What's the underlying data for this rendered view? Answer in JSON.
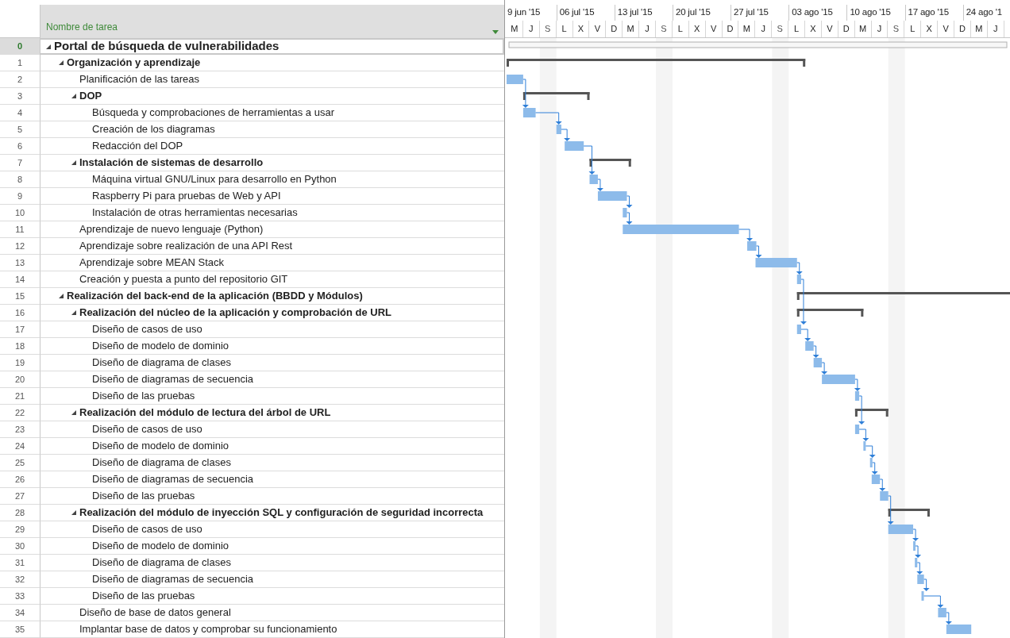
{
  "table": {
    "column_header": "Nombre de tarea"
  },
  "timescale": {
    "days": [
      {
        "label": "M",
        "nonworking": false
      },
      {
        "label": "J",
        "nonworking": false
      },
      {
        "label": "S",
        "nonworking": true
      },
      {
        "label": "L",
        "nonworking": false
      },
      {
        "label": "X",
        "nonworking": false
      },
      {
        "label": "V",
        "nonworking": false
      },
      {
        "label": "D",
        "nonworking": false
      },
      {
        "label": "M",
        "nonworking": false
      },
      {
        "label": "J",
        "nonworking": false
      },
      {
        "label": "S",
        "nonworking": true
      },
      {
        "label": "L",
        "nonworking": false
      },
      {
        "label": "X",
        "nonworking": false
      },
      {
        "label": "V",
        "nonworking": false
      },
      {
        "label": "D",
        "nonworking": false
      },
      {
        "label": "M",
        "nonworking": false
      },
      {
        "label": "J",
        "nonworking": false
      },
      {
        "label": "S",
        "nonworking": true
      },
      {
        "label": "L",
        "nonworking": false
      },
      {
        "label": "X",
        "nonworking": false
      },
      {
        "label": "V",
        "nonworking": false
      },
      {
        "label": "D",
        "nonworking": false
      },
      {
        "label": "M",
        "nonworking": false
      },
      {
        "label": "J",
        "nonworking": false
      },
      {
        "label": "S",
        "nonworking": true
      },
      {
        "label": "L",
        "nonworking": false
      },
      {
        "label": "X",
        "nonworking": false
      },
      {
        "label": "V",
        "nonworking": false
      },
      {
        "label": "D",
        "nonworking": false
      },
      {
        "label": "M",
        "nonworking": false
      },
      {
        "label": "J",
        "nonworking": false
      }
    ]
  },
  "weeks": [
    {
      "label": "9 jun '15"
    },
    {
      "label": "06 jul '15"
    },
    {
      "label": "13 jul '15"
    },
    {
      "label": "20 jul '15"
    },
    {
      "label": "27 jul '15"
    },
    {
      "label": "03 ago '15"
    },
    {
      "label": "10 ago '15"
    },
    {
      "label": "17 ago '15"
    },
    {
      "label": "24 ago '1"
    }
  ],
  "tasks": [
    {
      "id": "0",
      "name": "Portal de búsqueda de vulnerabilidades",
      "selected": true,
      "expanded": true,
      "children": [
        {
          "id": "1",
          "name": "Organización y aprendizaje",
          "selected": false,
          "expanded": true,
          "children": [
            {
              "id": "2",
              "name": "Planificación de las tareas",
              "selected": false
            },
            {
              "id": "3",
              "name": "DOP",
              "selected": false,
              "expanded": true,
              "children": [
                {
                  "id": "4",
                  "name": "Búsqueda y comprobaciones de herramientas a usar",
                  "selected": false
                },
                {
                  "id": "5",
                  "name": "Creación de los diagramas",
                  "selected": false
                },
                {
                  "id": "6",
                  "name": "Redacción del DOP",
                  "selected": false
                }
              ]
            },
            {
              "id": "7",
              "name": "Instalación de sistemas de desarrollo",
              "selected": false,
              "expanded": true,
              "children": [
                {
                  "id": "8",
                  "name": "Máquina virtual GNU/Linux para desarrollo en Python",
                  "selected": false
                },
                {
                  "id": "9",
                  "name": "Raspberry Pi para pruebas de Web y API",
                  "selected": false
                },
                {
                  "id": "10",
                  "name": "Instalación de otras herramientas necesarias",
                  "selected": false
                }
              ]
            },
            {
              "id": "11",
              "name": "Aprendizaje de nuevo lenguaje (Python)",
              "selected": false
            },
            {
              "id": "12",
              "name": "Aprendizaje sobre realización de una API Rest",
              "selected": false
            },
            {
              "id": "13",
              "name": "Aprendizaje sobre MEAN Stack",
              "selected": false
            },
            {
              "id": "14",
              "name": "Creación y puesta a punto del repositorio GIT",
              "selected": false
            }
          ]
        },
        {
          "id": "15",
          "name": "Realización del back-end de la aplicación (BBDD y Módulos)",
          "selected": false,
          "expanded": true,
          "children": [
            {
              "id": "16",
              "name": "Realización del núcleo de la aplicación y comprobación de URL",
              "selected": false,
              "expanded": true,
              "children": [
                {
                  "id": "17",
                  "name": "Diseño de casos de uso",
                  "selected": false
                },
                {
                  "id": "18",
                  "name": "Diseño de modelo de dominio",
                  "selected": false
                },
                {
                  "id": "19",
                  "name": "Diseño de diagrama de clases",
                  "selected": false
                },
                {
                  "id": "20",
                  "name": "Diseño de diagramas de secuencia",
                  "selected": false
                },
                {
                  "id": "21",
                  "name": "Diseño de las pruebas",
                  "selected": false
                }
              ]
            },
            {
              "id": "22",
              "name": "Realización del módulo de lectura del árbol de URL",
              "selected": false,
              "expanded": true,
              "children": [
                {
                  "id": "23",
                  "name": "Diseño de casos de uso",
                  "selected": false
                },
                {
                  "id": "24",
                  "name": "Diseño de modelo de dominio",
                  "selected": false
                },
                {
                  "id": "25",
                  "name": "Diseño de diagrama de clases",
                  "selected": false
                },
                {
                  "id": "26",
                  "name": "Diseño de diagramas de secuencia",
                  "selected": false
                },
                {
                  "id": "27",
                  "name": "Diseño de las pruebas",
                  "selected": false
                }
              ]
            },
            {
              "id": "28",
              "name": "Realización del módulo de inyección SQL y configuración de seguridad incorrecta",
              "selected": false,
              "expanded": true,
              "children": [
                {
                  "id": "29",
                  "name": "Diseño de casos de uso",
                  "selected": false
                },
                {
                  "id": "30",
                  "name": "Diseño de modelo de dominio",
                  "selected": false
                },
                {
                  "id": "31",
                  "name": "Diseño de diagrama de clases",
                  "selected": false
                },
                {
                  "id": "32",
                  "name": "Diseño de diagramas de secuencia",
                  "selected": false
                },
                {
                  "id": "33",
                  "name": "Diseño de las pruebas",
                  "selected": false
                }
              ]
            },
            {
              "id": "34",
              "name": "Diseño de base de datos general",
              "selected": false
            },
            {
              "id": "35",
              "name": "Implantar base de datos y comprobar su funcionamiento",
              "selected": false
            }
          ]
        }
      ]
    }
  ]
}
